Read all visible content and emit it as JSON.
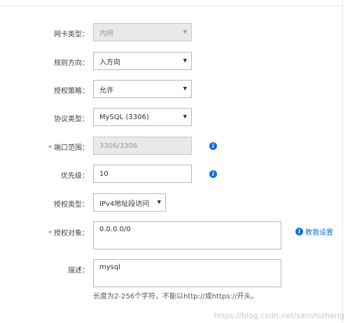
{
  "form": {
    "nic_type": {
      "label": "网卡类型：",
      "value": "内网",
      "disabled": true
    },
    "direction": {
      "label": "规则方向：",
      "value": "入方向"
    },
    "policy": {
      "label": "授权策略：",
      "value": "允许"
    },
    "protocol": {
      "label": "协议类型：",
      "value": "MySQL (3306)"
    },
    "port_range": {
      "label": "端口范围：",
      "required": true,
      "value": "3306/3306",
      "disabled": true
    },
    "priority": {
      "label": "优先级：",
      "value": "10"
    },
    "auth_type": {
      "label": "授权类型：",
      "value": "IPv4地址段访问"
    },
    "auth_object": {
      "label": "授权对象：",
      "required": true,
      "value": "0.0.0.0/0",
      "help_link": "教我设置"
    },
    "description": {
      "label": "描述：",
      "value": "mysql",
      "hint": "长度为2-256个字符，不能以http://或https://开头。"
    }
  },
  "icons": {
    "info": "info-icon",
    "dropdown": "caret-down-icon",
    "required": "asterisk"
  },
  "colors": {
    "link": "#0e6fd6",
    "required": "#e33d3d",
    "disabled_bg": "#e9e9e9"
  },
  "watermark": "https://blog.csdn.net/sanshizhang"
}
